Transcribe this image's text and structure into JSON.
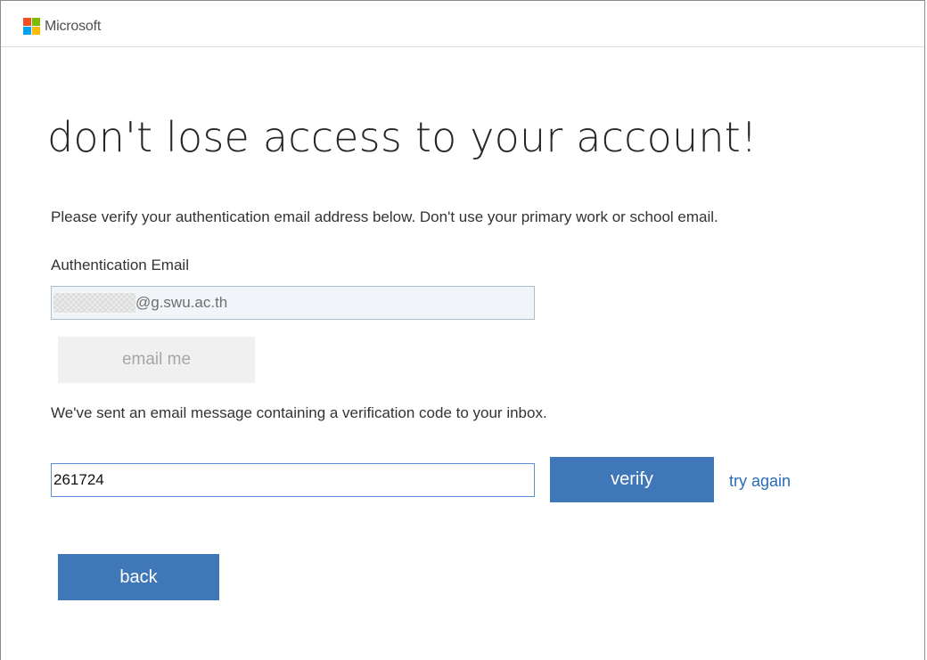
{
  "header": {
    "brand": "Microsoft",
    "logo_colors": [
      "#f25022",
      "#7fba00",
      "#00a4ef",
      "#ffb900"
    ]
  },
  "main": {
    "title": "don't lose access to your account!",
    "instruction": "Please verify your authentication email address below. Don't use your primary work or school email.",
    "auth_email_label": "Authentication Email",
    "auth_email_value": "@g.swu.ac.th",
    "email_me_label": "email me",
    "sent_message": "We've sent an email message containing a verification code to your inbox.",
    "code_value": "261724",
    "verify_label": "verify",
    "try_again_label": "try again",
    "back_label": "back"
  },
  "colors": {
    "primary_button": "#3f77b8",
    "link": "#2a6ab8",
    "disabled_button_bg": "#f0f0f0"
  }
}
